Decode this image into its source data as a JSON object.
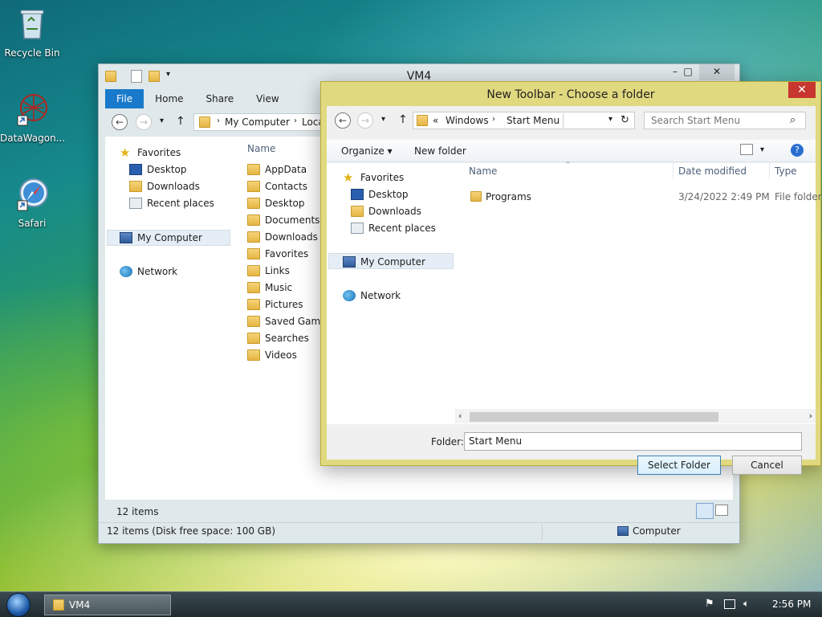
{
  "desktop": {
    "icons": [
      {
        "label": "Recycle Bin"
      },
      {
        "label": "DataWagon..."
      },
      {
        "label": "Safari"
      }
    ]
  },
  "explorer": {
    "title": "VM4",
    "ribbon_tabs": [
      "File",
      "Home",
      "Share",
      "View"
    ],
    "address": [
      "My Computer",
      "Loca"
    ],
    "nav": {
      "favorites": "Favorites",
      "desktop": "Desktop",
      "downloads": "Downloads",
      "recent": "Recent places",
      "computer": "My Computer",
      "network": "Network"
    },
    "column_name": "Name",
    "items": [
      "AppData",
      "Contacts",
      "Desktop",
      "Documents",
      "Downloads",
      "Favorites",
      "Links",
      "Music",
      "Pictures",
      "Saved Games",
      "Searches",
      "Videos"
    ],
    "count_label": "12 items",
    "status_left": "12 items (Disk free space: 100 GB)",
    "status_right": "Computer"
  },
  "dialog": {
    "title": "New Toolbar - Choose a folder",
    "close": "✕",
    "breadcrumb": [
      "Windows",
      "Start Menu"
    ],
    "breadcrumb_prefix": "«",
    "search_placeholder": "Search Start Menu",
    "organize": "Organize",
    "new_folder": "New folder",
    "nav": {
      "favorites": "Favorites",
      "desktop": "Desktop",
      "downloads": "Downloads",
      "recent": "Recent places",
      "computer": "My Computer",
      "network": "Network"
    },
    "columns": [
      "Name",
      "Date modified",
      "Type"
    ],
    "rows": [
      {
        "name": "Programs",
        "date": "3/24/2022 2:49 PM",
        "type": "File folder"
      }
    ],
    "folder_label": "Folder:",
    "folder_value": "Start Menu",
    "select_button": "Select Folder",
    "cancel_button": "Cancel"
  },
  "taskbar": {
    "task_label": "VM4",
    "clock": "2:56 PM"
  }
}
